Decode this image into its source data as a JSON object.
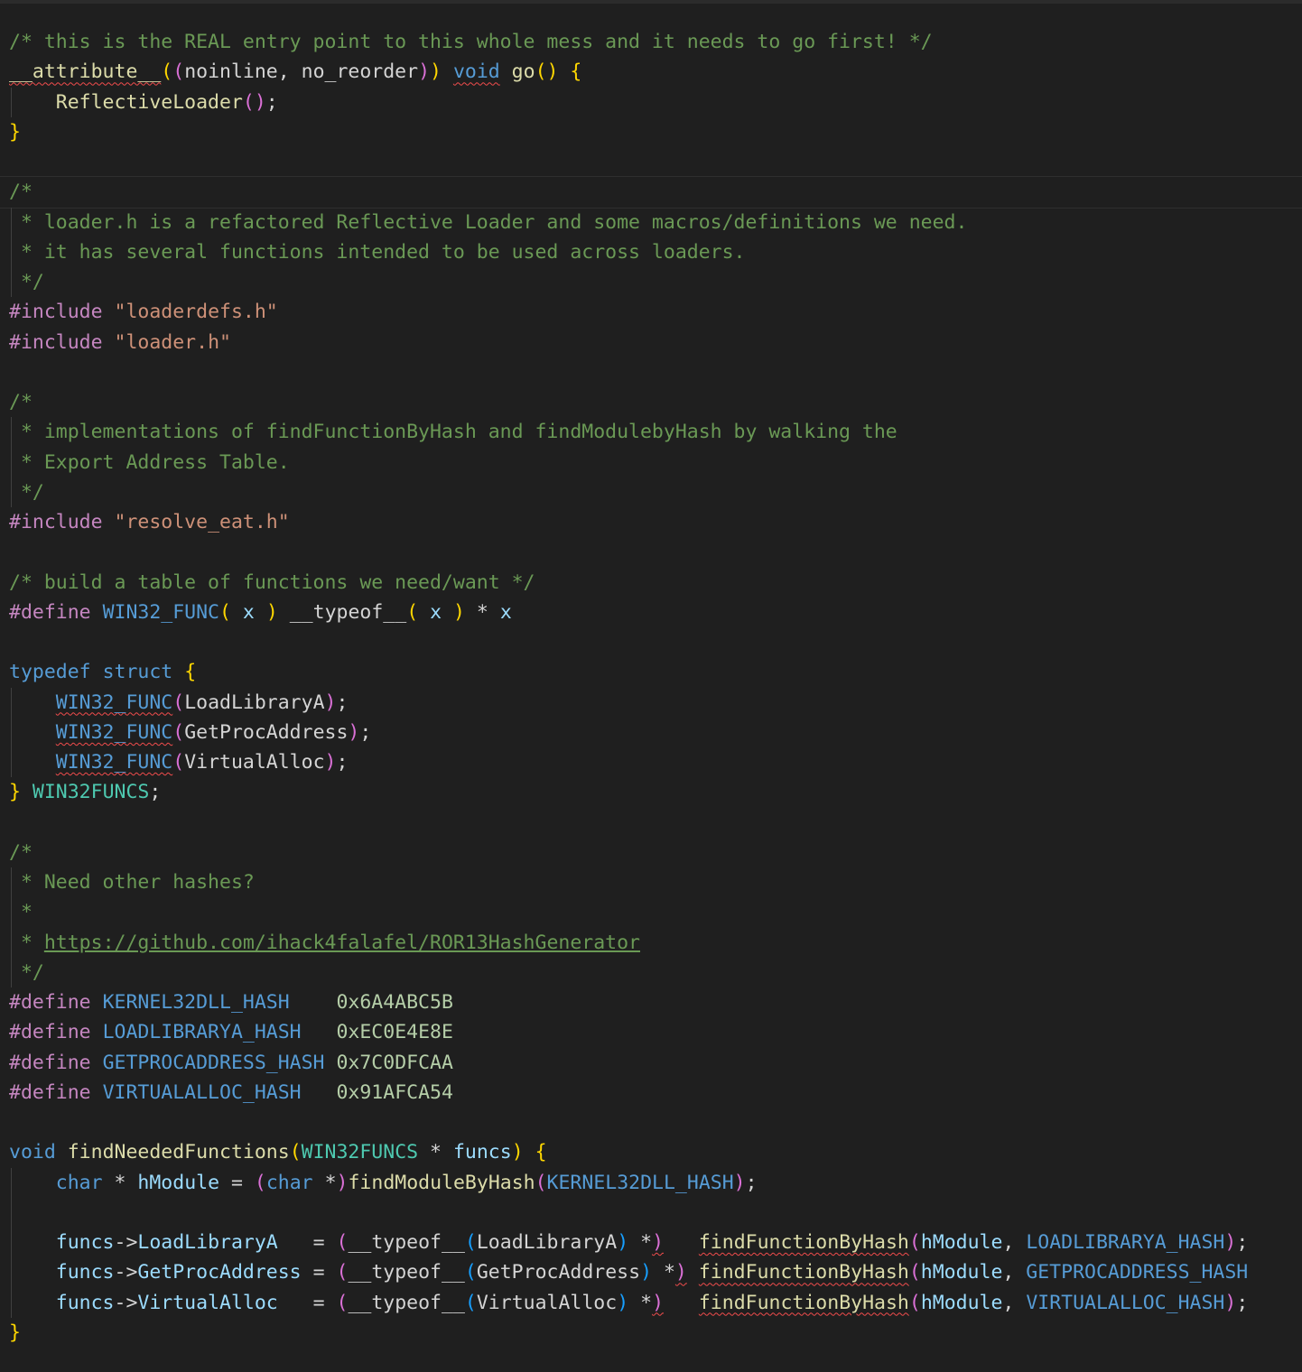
{
  "editor": {
    "language": "c"
  },
  "colors": {
    "background": "#1f1f1f",
    "comment": "#6a9955",
    "preprocessor": "#c586c0",
    "keyword": "#569cd6",
    "function": "#dcdcaa",
    "string": "#ce9178",
    "type": "#4ec9b0",
    "error_squiggle": "#f14c4c"
  },
  "code": {
    "entry_comment": "/* this is the REAL entry point to this whole mess and it needs to go first! */",
    "attr_name": "__attribute__",
    "attr_args": "noinline, no_reorder",
    "void_kw": "void",
    "go_fn": "go",
    "reflective_loader": "ReflectiveLoader",
    "c1_open": "/*",
    "c1_l1": " * loader.h is a refactored Reflective Loader and some macros/definitions we need.",
    "c1_l2": " * it has several functions intended to be used across loaders.",
    "c_close": " */",
    "include_kw": "#include",
    "inc1": "\"loaderdefs.h\"",
    "inc2": "\"loader.h\"",
    "c2_l1": " * implementations of findFunctionByHash and findModulebyHash by walking the",
    "c2_l2": " * Export Address Table.",
    "inc3": "\"resolve_eat.h\"",
    "c3": "/* build a table of functions we need/want */",
    "define_kw": "#define",
    "win32_func": "WIN32_FUNC",
    "x_param": "x",
    "typeof_kw": "__typeof__",
    "typedef_kw": "typedef",
    "struct_kw": "struct",
    "loadlibrarya": "LoadLibraryA",
    "getprocaddress": "GetProcAddress",
    "virtualalloc": "VirtualAlloc",
    "win32funcs": "WIN32FUNCS",
    "c4_l1": " * Need other hashes?",
    "c4_l2": " *",
    "c4_l3_prefix": " * ",
    "c4_link": "https://github.com/ihack4falafel/ROR13HashGenerator",
    "kernel32_hash": "KERNEL32DLL_HASH",
    "kernel32_val": "0x6A4ABC5B",
    "loadlib_hash": "LOADLIBRARYA_HASH",
    "loadlib_val": "0xEC0E4E8E",
    "getproc_hash": "GETPROCADDRESS_HASH",
    "getproc_val": "0x7C0DFCAA",
    "valloc_hash": "VIRTUALALLOC_HASH",
    "valloc_val": "0x91AFCA54",
    "find_needed": "findNeededFunctions",
    "funcs_param": "funcs",
    "char_kw": "char",
    "hmodule": "hModule",
    "find_module": "findModuleByHash",
    "find_function": "findFunctionByHash"
  }
}
